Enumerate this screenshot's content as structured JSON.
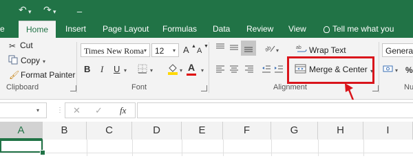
{
  "quick_access": {
    "undo_icon": "undo-icon",
    "redo_icon": "redo-icon",
    "customize_icon": "customize-icon",
    "undo_glyph": "↶",
    "redo_glyph": "↷",
    "customize_glyph": "⚊"
  },
  "tabs": {
    "file_partial": "e",
    "home": "Home",
    "insert": "Insert",
    "page_layout": "Page Layout",
    "formulas": "Formulas",
    "data": "Data",
    "review": "Review",
    "view": "View",
    "tell_me": "Tell me what you want t"
  },
  "clipboard": {
    "cut": "Cut",
    "copy": "Copy",
    "format_painter": "Format Painter",
    "label": "Clipboard"
  },
  "font": {
    "name": "Times New Roma",
    "size": "12",
    "grow": "A",
    "shrink": "A",
    "bold": "B",
    "italic": "I",
    "underline": "U",
    "font_color_letter": "A",
    "label": "Font"
  },
  "alignment": {
    "wrap_text": "Wrap Text",
    "merge_center": "Merge & Center",
    "label": "Alignment"
  },
  "number": {
    "format": "General",
    "label_partial": "Nu"
  },
  "formula_bar": {
    "fx": "fx",
    "cancel": "✕",
    "enter": "✓",
    "value": ""
  },
  "columns": [
    "A",
    "B",
    "C",
    "D",
    "E",
    "F",
    "G",
    "H",
    "I"
  ],
  "colors": {
    "excel_green": "#217346",
    "highlight_red": "#d9141b",
    "font_color_bar": "#e00000",
    "fill_yellow": "#ffd800"
  }
}
